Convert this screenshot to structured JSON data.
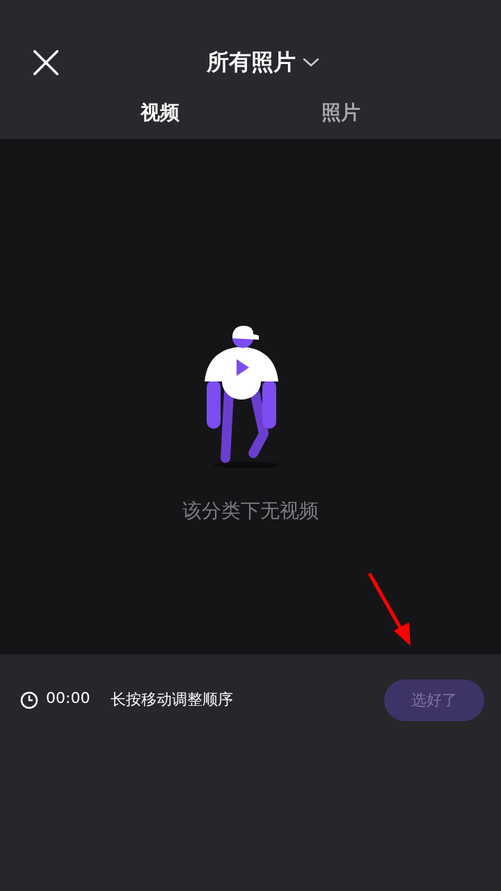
{
  "header": {
    "title": "所有照片"
  },
  "tabs": [
    {
      "label": "视频",
      "selected": true
    },
    {
      "label": "照片",
      "selected": false
    }
  ],
  "empty_state": {
    "message": "该分类下无视频"
  },
  "footer": {
    "duration": "00:00",
    "hint": "长按移动调整顺序",
    "confirm_button": {
      "label": "选好了",
      "disabled": true
    }
  }
}
